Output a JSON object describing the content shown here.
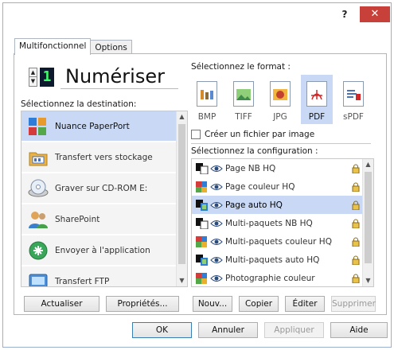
{
  "titlebar": {
    "help_label": "?",
    "close_label": "✕"
  },
  "tabs": [
    {
      "label": "Multifonctionnel",
      "active": true
    },
    {
      "label": "Options",
      "active": false
    }
  ],
  "scan": {
    "digit": "1",
    "title": "Numériser"
  },
  "destination": {
    "label": "Sélectionnez la destination:",
    "items": [
      {
        "label": "Nuance PaperPort",
        "icon": "paperport-icon",
        "selected": true
      },
      {
        "label": "Transfert vers stockage",
        "icon": "storage-folder-icon",
        "selected": false
      },
      {
        "label": "Graver sur CD-ROM  E:",
        "icon": "cd-rom-icon",
        "selected": false
      },
      {
        "label": "SharePoint",
        "icon": "sharepoint-icon",
        "selected": false
      },
      {
        "label": "Envoyer à l'application",
        "icon": "send-application-icon",
        "selected": false
      },
      {
        "label": "Transfert FTP",
        "icon": "ftp-icon",
        "selected": false
      }
    ]
  },
  "format": {
    "label": "Sélectionnez le format :",
    "items": [
      {
        "name": "BMP",
        "selected": false,
        "color": "#d48a2a"
      },
      {
        "name": "TIFF",
        "selected": false,
        "color": "#3f8c4a"
      },
      {
        "name": "JPG",
        "selected": false,
        "color": "#c2412e"
      },
      {
        "name": "PDF",
        "selected": true,
        "color": "#d02828"
      },
      {
        "name": "sPDF",
        "selected": false,
        "color": "#4a72b8"
      }
    ]
  },
  "single_file": {
    "label": "Créer un fichier par image",
    "checked": false
  },
  "configuration": {
    "label": "Sélectionnez la configuration :",
    "items": [
      {
        "label": "Page NB HQ",
        "icon": "bw-page-icon",
        "selected": false
      },
      {
        "label": "Page couleur HQ",
        "icon": "color-page-icon",
        "selected": false
      },
      {
        "label": "Page auto HQ",
        "icon": "auto-page-icon",
        "selected": true
      },
      {
        "label": "Multi-paquets NB HQ",
        "icon": "bw-page-icon",
        "selected": false
      },
      {
        "label": "Multi-paquets couleur HQ",
        "icon": "color-page-icon",
        "selected": false
      },
      {
        "label": "Multi-paquets auto HQ",
        "icon": "auto-page-icon",
        "selected": false
      },
      {
        "label": "Photographie couleur",
        "icon": "color-page-icon",
        "selected": false
      }
    ]
  },
  "buttons": {
    "refresh": "Actualiser",
    "properties": "Propriétés...",
    "new": "Nouv...",
    "copy": "Copier",
    "edit": "Éditer",
    "delete": "Supprimer",
    "ok": "OK",
    "cancel": "Annuler",
    "apply": "Appliquer",
    "help": "Aide"
  },
  "colors": {
    "selection": "#c9d9f5",
    "close_button": "#c7403a",
    "digit_text": "#3cff6a"
  }
}
